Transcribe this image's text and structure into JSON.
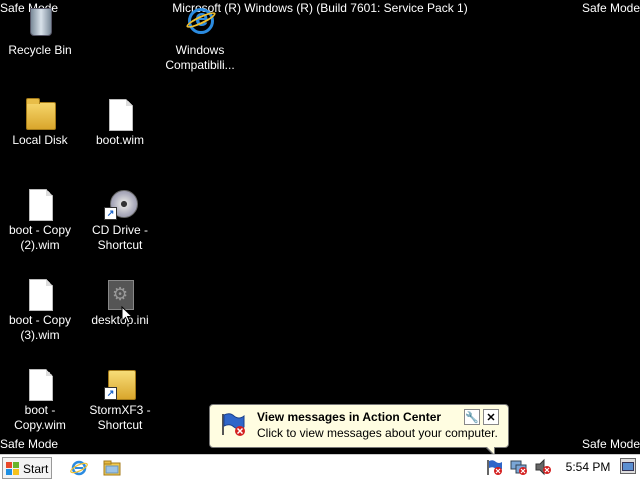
{
  "os_banner": {
    "title": "Microsoft (R) Windows (R) (Build 7601: Service Pack 1)",
    "safe_mode": "Safe Mode"
  },
  "desktop_icons": [
    {
      "label": "Recycle Bin",
      "icon": "recycle-bin-icon"
    },
    {
      "label": "Windows Compatibili...",
      "icon": "internet-explorer-icon"
    },
    {
      "label": "Local Disk",
      "icon": "folder-icon"
    },
    {
      "label": "boot.wim",
      "icon": "file-icon"
    },
    {
      "label": "boot - Copy (2).wim",
      "icon": "file-icon"
    },
    {
      "label": "CD Drive - Shortcut",
      "icon": "cd-drive-shortcut-icon"
    },
    {
      "label": "boot - Copy (3).wim",
      "icon": "file-icon"
    },
    {
      "label": "desktop.ini",
      "icon": "settings-file-icon"
    },
    {
      "label": "boot - Copy.wim",
      "icon": "file-icon"
    },
    {
      "label": "StormXF3 - Shortcut",
      "icon": "folder-shortcut-icon"
    }
  ],
  "notification": {
    "title": "View messages in Action Center",
    "subtitle": "Click to view messages about your computer.",
    "icon": "action-center-flag-icon"
  },
  "taskbar": {
    "start_label": "Start",
    "clock": "5:54 PM",
    "quick_launch": [
      "internet-explorer-icon",
      "windows-explorer-icon"
    ],
    "tray_icons": [
      "action-center-flag-icon",
      "network-error-icon",
      "volume-muted-icon"
    ]
  }
}
